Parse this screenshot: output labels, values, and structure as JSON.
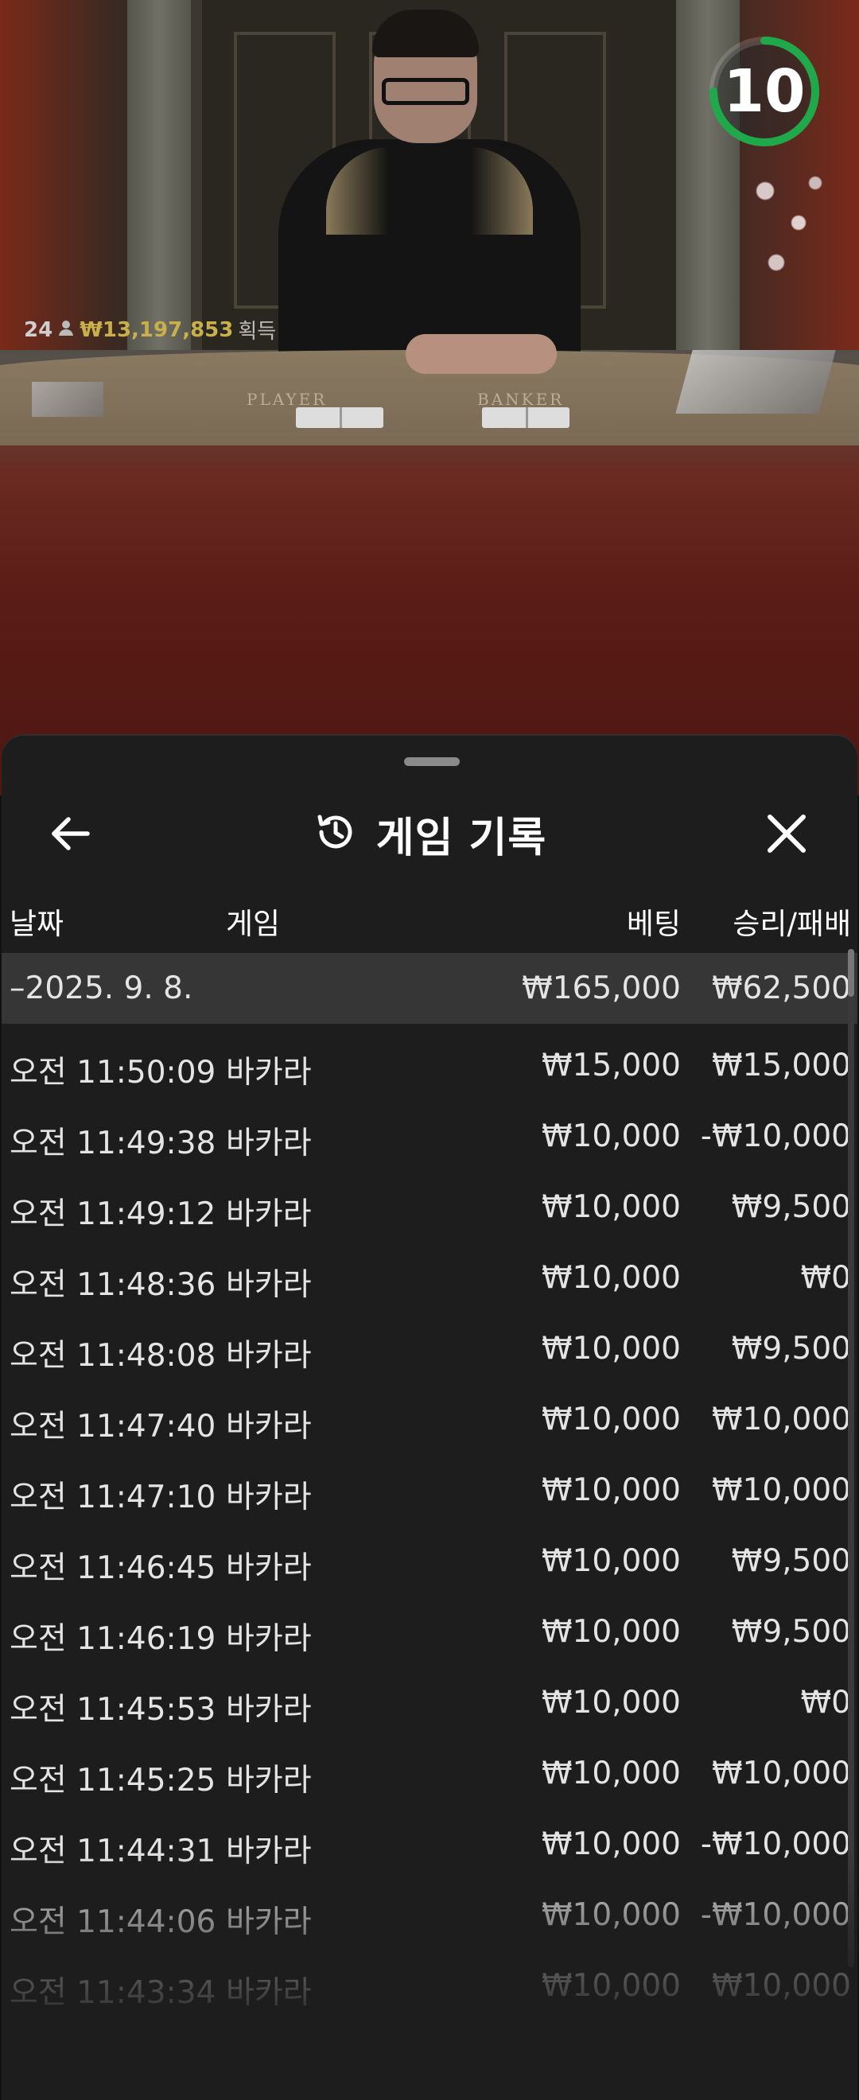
{
  "video": {
    "round_number": "24",
    "total_winnings": "₩13,197,853",
    "winnings_label": "획득",
    "countdown": "10",
    "countdown_fraction": 0.75,
    "player_label": "PLAYER",
    "banker_label": "BANKER"
  },
  "sheet": {
    "title": "게임 기록",
    "back_icon": "arrow-left-icon",
    "history_icon": "history-clock-icon",
    "close_icon": "close-x-icon"
  },
  "table": {
    "headers": {
      "date": "날짜",
      "game": "게임",
      "bet": "베팅",
      "result": "승리/패배"
    },
    "summary": {
      "date": "–2025. 9. 8.",
      "bet": "₩165,000",
      "result": "₩62,500"
    },
    "rows": [
      {
        "time": "오전 11:50:09",
        "game": "바카라",
        "bet": "₩15,000",
        "result": "₩15,000"
      },
      {
        "time": "오전 11:49:38",
        "game": "바카라",
        "bet": "₩10,000",
        "result": "-₩10,000"
      },
      {
        "time": "오전 11:49:12",
        "game": "바카라",
        "bet": "₩10,000",
        "result": "₩9,500"
      },
      {
        "time": "오전 11:48:36",
        "game": "바카라",
        "bet": "₩10,000",
        "result": "₩0"
      },
      {
        "time": "오전 11:48:08",
        "game": "바카라",
        "bet": "₩10,000",
        "result": "₩9,500"
      },
      {
        "time": "오전 11:47:40",
        "game": "바카라",
        "bet": "₩10,000",
        "result": "₩10,000"
      },
      {
        "time": "오전 11:47:10",
        "game": "바카라",
        "bet": "₩10,000",
        "result": "₩10,000"
      },
      {
        "time": "오전 11:46:45",
        "game": "바카라",
        "bet": "₩10,000",
        "result": "₩9,500"
      },
      {
        "time": "오전 11:46:19",
        "game": "바카라",
        "bet": "₩10,000",
        "result": "₩9,500"
      },
      {
        "time": "오전 11:45:53",
        "game": "바카라",
        "bet": "₩10,000",
        "result": "₩0"
      },
      {
        "time": "오전 11:45:25",
        "game": "바카라",
        "bet": "₩10,000",
        "result": "₩10,000"
      },
      {
        "time": "오전 11:44:31",
        "game": "바카라",
        "bet": "₩10,000",
        "result": "-₩10,000"
      },
      {
        "time": "오전 11:44:06",
        "game": "바카라",
        "bet": "₩10,000",
        "result": "-₩10,000"
      },
      {
        "time": "오전 11:43:34",
        "game": "바카라",
        "bet": "₩10,000",
        "result": "₩10,000"
      }
    ]
  },
  "colors": {
    "timer_green": "#1fa94a",
    "sheet_bg": "#1d1d1d",
    "summary_bg": "#363636",
    "winnings_gold": "#c9b04a"
  }
}
